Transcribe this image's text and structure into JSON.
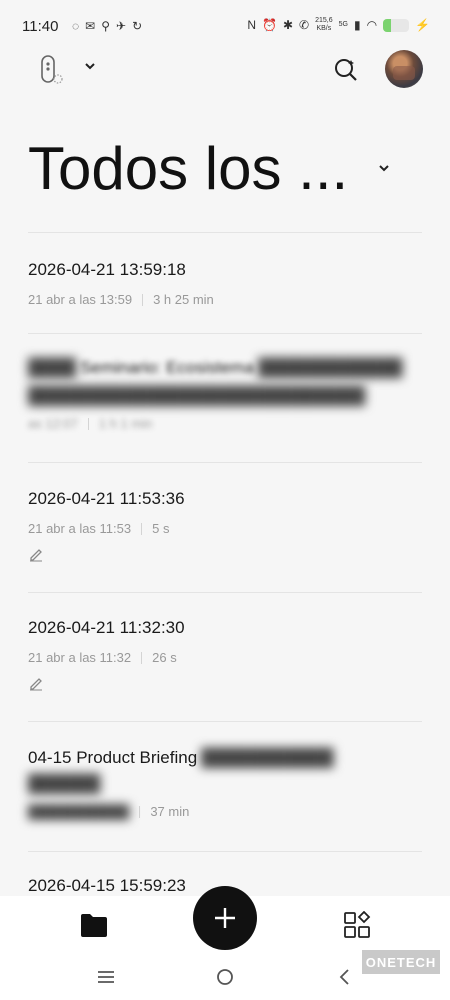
{
  "status_bar": {
    "time": "11:40",
    "net_speed_value": "215,6",
    "net_speed_unit": "KB/s",
    "network": "5G",
    "battery_level": 0.3
  },
  "header": {
    "app_icon": "recorder-app-icon",
    "ai_search_icon": "ai-search-icon",
    "avatar": "user-avatar"
  },
  "folder_title": "Todos los ...",
  "recordings": [
    {
      "title": "2026-04-21 13:59:18",
      "date": "21 abr a las 13:59",
      "duration": "3 h 25 min",
      "has_note": false
    },
    {
      "title": "Seminario: Ecosistema",
      "date": "as 12:07",
      "duration": "1 h 1 min",
      "has_note": false,
      "blurred": true
    },
    {
      "title": "2026-04-21 11:53:36",
      "date": "21 abr a las 11:53",
      "duration": "5 s",
      "has_note": true
    },
    {
      "title": "2026-04-21 11:32:30",
      "date": "21 abr a las 11:32",
      "duration": "26 s",
      "has_note": true
    },
    {
      "title": "04-15 Product Briefing",
      "date": "",
      "duration": "37 min",
      "has_note": false,
      "blurred": true
    },
    {
      "title": "2026-04-15 15:59:23",
      "date": "",
      "duration": "",
      "has_note": false
    }
  ],
  "watermark": "ONETECH",
  "colors": {
    "accent": "#111111",
    "meta": "#999999",
    "battery": "#7bd36f"
  }
}
